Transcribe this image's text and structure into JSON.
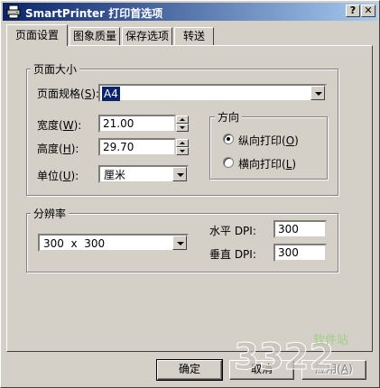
{
  "window": {
    "title": "SmartPrinter 打印首选项",
    "help_btn": "?",
    "close_btn": "✕"
  },
  "tabs": [
    {
      "label": "页面设置"
    },
    {
      "label": "图象质量"
    },
    {
      "label": "保存选项"
    },
    {
      "label": "转送"
    }
  ],
  "page_size": {
    "group_label": "页面大小",
    "size_label": "页面规格(",
    "size_key": "S",
    "size_value": "A4",
    "width_label": "宽度(",
    "width_key": "W",
    "width_value": "21.00",
    "height_label": "高度(",
    "height_key": "H",
    "height_value": "29.70",
    "unit_label": "单位(",
    "unit_key": "U",
    "unit_value": "厘米",
    "close_paren": "):"
  },
  "orientation": {
    "group_label": "方向",
    "portrait_label": "纵向打印(",
    "portrait_key": "O",
    "landscape_label": "横向打印(",
    "landscape_key": "L",
    "close_paren": ")",
    "selected": "portrait"
  },
  "resolution": {
    "group_label": "分辨率",
    "preset_value": "300  x  300",
    "horizontal_label": "水平 DPI:",
    "horizontal_value": "300",
    "vertical_label": "垂直 DPI:",
    "vertical_value": "300"
  },
  "buttons": {
    "ok": "确定",
    "cancel": "取消",
    "apply_label": "应用(",
    "apply_key": "A",
    "apply_close": ")"
  },
  "watermark": {
    "text": "3322",
    "sub": "软件站"
  },
  "icons": {
    "app": "printer-icon"
  }
}
